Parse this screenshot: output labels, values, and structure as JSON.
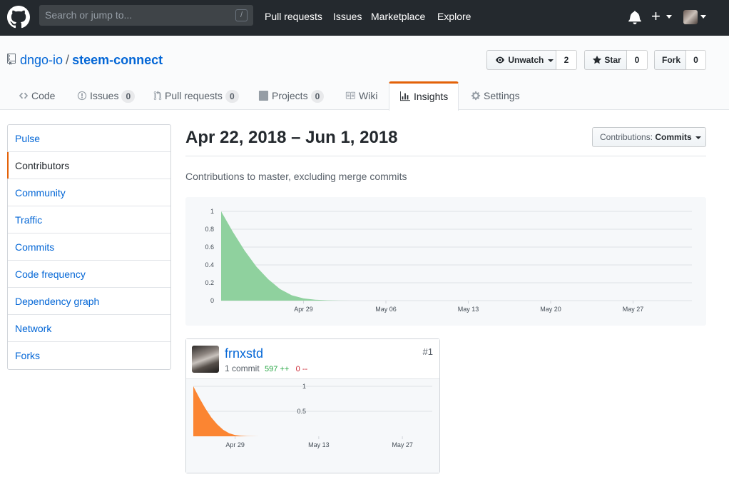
{
  "header": {
    "search_placeholder": "Search or jump to...",
    "search_key": "/",
    "nav": [
      "Pull requests",
      "Issues",
      "Marketplace",
      "Explore"
    ]
  },
  "repo": {
    "owner": "dngo-io",
    "separator": "/",
    "name": "steem-connect",
    "watch": {
      "label": "Unwatch",
      "count": "2"
    },
    "star": {
      "label": "Star",
      "count": "0"
    },
    "fork": {
      "label": "Fork",
      "count": "0"
    }
  },
  "tabs": [
    {
      "label": "Code",
      "icon": "code-icon"
    },
    {
      "label": "Issues",
      "count": "0",
      "icon": "issue-icon"
    },
    {
      "label": "Pull requests",
      "count": "0",
      "icon": "pull-request-icon"
    },
    {
      "label": "Projects",
      "count": "0",
      "icon": "project-icon"
    },
    {
      "label": "Wiki",
      "icon": "book-icon"
    },
    {
      "label": "Insights",
      "icon": "graph-icon",
      "selected": true
    },
    {
      "label": "Settings",
      "icon": "gear-icon"
    }
  ],
  "sidebar": {
    "items": [
      "Pulse",
      "Contributors",
      "Community",
      "Traffic",
      "Commits",
      "Code frequency",
      "Dependency graph",
      "Network",
      "Forks"
    ],
    "selected": "Contributors"
  },
  "main": {
    "date_range": "Apr 22, 2018 – Jun 1, 2018",
    "select_prefix": "Contributions:",
    "select_value": "Commits",
    "subtitle": "Contributions to master, excluding merge commits"
  },
  "contributor": {
    "name": "frnxstd",
    "rank": "#1",
    "commits": "1 commit",
    "additions": "597 ++",
    "deletions": "0 --"
  },
  "colors": {
    "accent": "#e36209",
    "link": "#0366d6",
    "main_area": "#8fd19e",
    "user_area": "#fb8532"
  },
  "chart_data": [
    {
      "type": "area",
      "x": [
        "Apr 22",
        "Apr 23",
        "Apr 24",
        "Apr 25",
        "Apr 26",
        "Apr 27",
        "Apr 28",
        "Apr 29",
        "Apr 30",
        "May 01",
        "May 02",
        "May 03",
        "May 04",
        "May 05",
        "May 06",
        "May 13",
        "May 20",
        "May 27",
        "Jun 01"
      ],
      "y": [
        1,
        0.77,
        0.56,
        0.38,
        0.24,
        0.13,
        0.06,
        0.025,
        0.01,
        0.004,
        0.001,
        0,
        0,
        0,
        0,
        0,
        0,
        0,
        0
      ],
      "x_ticks": [
        "Apr 29",
        "May 06",
        "May 13",
        "May 20",
        "May 27"
      ],
      "y_ticks": [
        "0",
        "0.2",
        "0.4",
        "0.6",
        "0.8",
        "1"
      ],
      "ylim": [
        0,
        1
      ],
      "grid": true
    },
    {
      "type": "area",
      "x": [
        "Apr 22",
        "Apr 23",
        "Apr 24",
        "Apr 25",
        "Apr 26",
        "Apr 27",
        "Apr 28",
        "Apr 29",
        "Apr 30",
        "May 01",
        "May 02",
        "May 03",
        "May 04",
        "May 05",
        "May 06",
        "May 13",
        "May 20",
        "May 27",
        "Jun 01"
      ],
      "y": [
        1,
        0.77,
        0.56,
        0.38,
        0.24,
        0.13,
        0.06,
        0.025,
        0.01,
        0.004,
        0.001,
        0,
        0,
        0,
        0,
        0,
        0,
        0,
        0
      ],
      "x_ticks": [
        "Apr 29",
        "May 13",
        "May 27"
      ],
      "y_ticks": [
        "0.5",
        "1"
      ],
      "ylim": [
        0,
        1
      ],
      "grid": true
    }
  ]
}
